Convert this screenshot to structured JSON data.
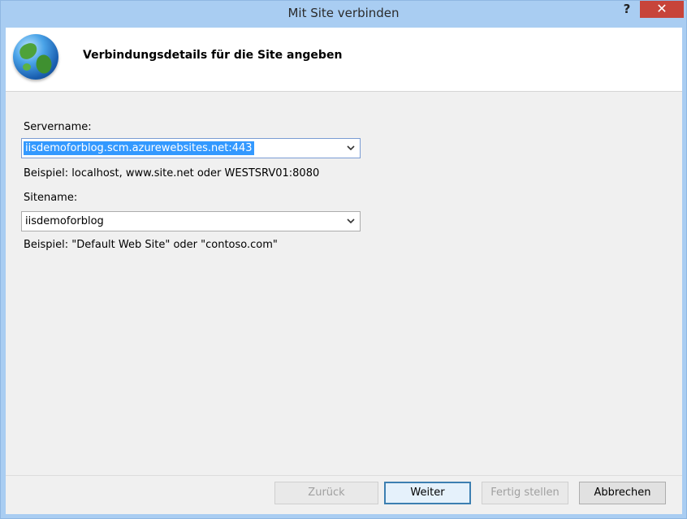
{
  "window": {
    "title": "Mit Site verbinden",
    "help_label": "?",
    "close_label": "✕"
  },
  "header": {
    "title": "Verbindungsdetails für die Site angeben",
    "icon": "globe-icon"
  },
  "form": {
    "server": {
      "label": "Servername:",
      "value": "iisdemoforblog.scm.azurewebsites.net:443",
      "hint": "Beispiel: localhost, www.site.net oder WESTSRV01:8080"
    },
    "site": {
      "label": "Sitename:",
      "value": "iisdemoforblog",
      "hint": "Beispiel: \"Default Web Site\" oder \"contoso.com\""
    }
  },
  "buttons": {
    "back": "Zurück",
    "next": "Weiter",
    "finish": "Fertig stellen",
    "cancel": "Abbrechen"
  },
  "colors": {
    "titlebar": "#a9cdf2",
    "close": "#c7443a",
    "selection": "#3399ff"
  }
}
